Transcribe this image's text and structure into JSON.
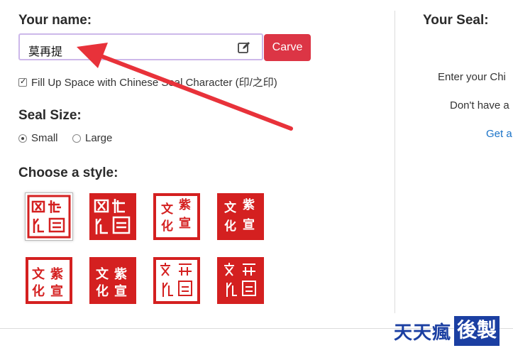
{
  "form": {
    "name_label": "Your name:",
    "name_value": "莫再提",
    "carve_label": "Carve",
    "fill_checkbox_label": "Fill Up Space with Chinese Seal Character (印/之印)",
    "fill_checked": true,
    "size_label": "Seal Size:",
    "size_options": [
      {
        "label": "Small",
        "selected": true
      },
      {
        "label": "Large",
        "selected": false
      }
    ],
    "style_label": "Choose a style:",
    "accent_color": "#dc3545",
    "input_border_color": "#cdb8ea"
  },
  "right_panel": {
    "title": "Your Seal:",
    "line1": "Enter your Chi",
    "line2": "Don't have a",
    "link": "Get a"
  },
  "watermark": {
    "text": "天天瘋",
    "box_text": "後製",
    "color": "#1b3fa2"
  },
  "annotation": {
    "arrow_color": "#e8323a"
  }
}
